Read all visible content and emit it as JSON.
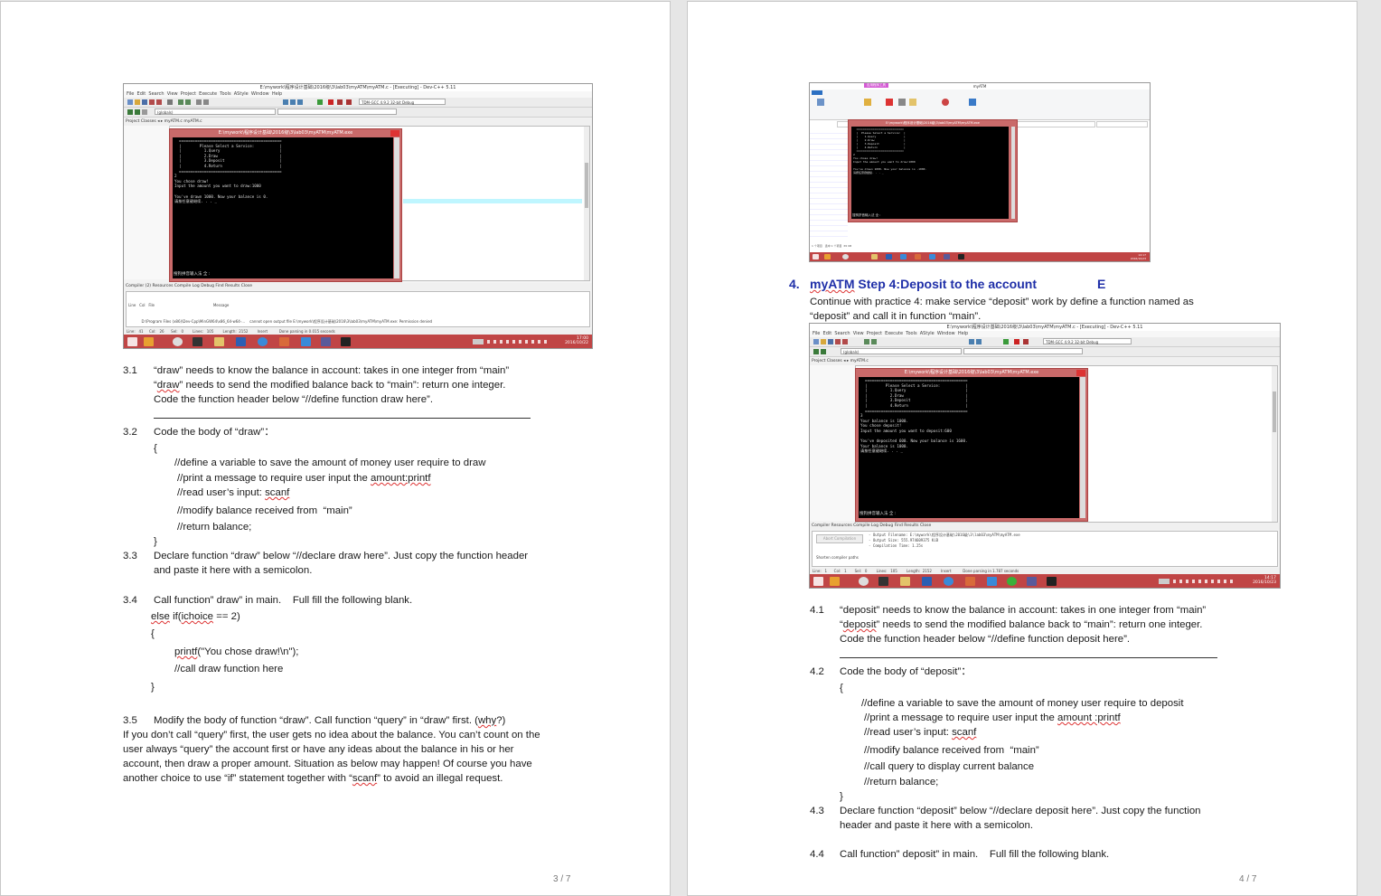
{
  "page_left": {
    "screenshot": {
      "window_title": "E:\\mywork\\程序设计基础\\2016级\\3\\lab03\\myATM\\myATM.c - [Executing] - Dev-C++ 5.11",
      "menu": "File  Edit  Search  View  Project  Execute  Tools  AStyle  Window  Help",
      "compiler_combo": "TDM-GCC 4.9.2 32-bit Debug",
      "globals_combo": "(globals)",
      "tabs": "Project  Classes  ◂ ▸   myATM.c   myATM.c",
      "console_title": "E:\\mywork\\程序设计基础\\2016级\\3\\lab03\\myATM\\myATM.exe",
      "console_text": "  =============================================\n  |        Please Select a Service:           |\n  |          1.Query                          |\n  |          2.Draw                           |\n  |          3.Deposit                        |\n  |          4.Return                         |\n  =============================================\n2\nYou chose draw!\nInput the amount you want to draw:1000\n\nYou've drawn 1000. Now your balance is 0.\n请按任意键继续. . . _",
      "ime_text": "搜狗拼音输入法 全 :",
      "bottom_tabs": "Compiler (2)   Resources   Compile Log   Debug   Find Results   Close",
      "log_header": "Line   Col   File                                                   Message",
      "log_line1": "             D:\\Program Files (x86)\\Dev-Cpp\\MinGW64\\x86_64-w64-...    cannot open output file E:\\mywork\\程序设计基础\\2016\\3\\lab03\\myATM\\myATM.exe: Permission denied",
      "log_line2": "             E:\\mywork\\程序设计基础\\2016\\3\\lab03\\myATM\\coll...          [Error] ld returned 1 exit status",
      "status": "Line:   41     Col:   26      Sel:   0        Lines:   105        Length:  2152        Insert          Done parsing in 0.015 seconds",
      "clock_time": "17:00",
      "clock_date": "2016/10/22"
    },
    "s31_num": "3.1",
    "s31_l1": "“draw” needs to know the balance in account: takes in one integer from “main”",
    "s31_l2a": "“",
    "s31_l2b": "draw",
    "s31_l2c": "” needs to send the modified balance back to “main”: return one integer.",
    "s31_l3": "Code the function header below “//define function draw here”.",
    "s32_num": "3.2",
    "s32_l1": "Code the body of “draw”：",
    "brace_open": "{",
    "s32_c1": "//define a variable to save the amount of money user require to draw",
    "s32_c2a": "//print a message to require user input the ",
    "s32_c2b": "amount:printf",
    "s32_c3a": "//read user’s input: ",
    "s32_c3b": "scanf",
    "s32_c4": "//modify balance received from  “main”",
    "s32_c5": "//return balance;",
    "brace_close": "}",
    "s33_num": "3.3",
    "s33_l1": "Declare function “draw” below “//declare draw here”. Just copy the function header",
    "s33_l2": "and paste it here with a semicolon.",
    "s34_num": "3.4",
    "s34_l1": "Call function” draw” in main.    Full fill the following blank.",
    "s34_c1a": "else",
    "s34_c1b": " if(",
    "s34_c1c": "ichoice",
    "s34_c1d": " == 2)",
    "s34_c2": "{",
    "s34_c3a": "printf",
    "s34_c3b": "(\"You chose draw!\\n\");",
    "s34_c4": "//call draw function here",
    "s34_c5": "}",
    "s35_num": "3.5",
    "s35_l1a": "Modify the body of function “draw”. Call function “query” in “draw” first. (",
    "s35_l1b": "why",
    "s35_l1c": "?)",
    "s35_p1": "If you don’t call “query” first, the user gets no idea about the balance. You can’t count on the",
    "s35_p2": "user always “query” the account first or have any ideas about the balance in his or her",
    "s35_p3": "account, then draw a proper amount. Situation as below may happen! Of course you have",
    "s35_p4a": "another choice to use “if” statement together with “",
    "s35_p4b": "scanf",
    "s35_p4c": "” to avoid an illegal request.",
    "page_number": "3 / 7"
  },
  "page_right": {
    "explorer_shot": {
      "title": "myATM",
      "ribbon_label": "应用程序工具",
      "console_title": "E:\\mywork\\程序设计基础\\2016级\\3\\lab03\\myATM\\myATM.exe",
      "console_text": "  =============================\n  |  Please Select a Service:  |\n  |    1.Query                 |\n  |    2.Draw                  |\n  |    3.Deposit               |\n  |    4.Return                |\n  =============================\n2\nYou chose draw!\nInput the amount you want to draw:1000\n\nYou've drawn 1000. Now your balance is -1000.\n请按任意键继续. . . _",
      "ime_text": "搜狗拼音输入法 全 :",
      "status": "1 个项目   选中 1 个项目  65 KB",
      "clock_time": "14:17",
      "clock_date": "2016/10/23"
    },
    "h4_num": "4.",
    "h4_a": "myATM",
    "h4_b": " Step 4:Deposit to the account",
    "h4_c": "E",
    "intro1": "Continue with practice 4: make service “deposit” work by define a function named as",
    "intro2": "“deposit” and call it in function “main”.",
    "screenshot": {
      "window_title": "E:\\mywork\\程序设计基础\\2016级\\3\\lab03\\myATM\\myATM.c - [Executing] - Dev-C++ 5.11",
      "menu": "File  Edit  Search  View  Project  Execute  Tools  AStyle  Window  Help",
      "compiler_combo": "TDM-GCC 4.9.2 32-bit Debug",
      "globals_combo": "(globals)",
      "tabs": "Project  Classes  ◂ ▸   myATM.c",
      "console_title": "E:\\mywork\\程序设计基础\\2016级\\3\\lab03\\myATM\\myATM.exe",
      "console_text": "  =============================================\n  |        Please Select a Service:           |\n  |          1.Query                          |\n  |          2.Draw                           |\n  |          3.Deposit                        |\n  |          4.Return                         |\n  =============================================\n3\nYour balance is 1000.\nYou chose deposit!\nInput the amount you want to deposit:600\n\nYou've deposited 600. Now your balance is 1600.\nYour balance is 1000.\n请按任意键继续. . . _",
      "ime_text": "搜狗拼音输入法 全 :",
      "bottom_tabs": "Compiler   Resources   Compile Log   Debug   Find Results   Close",
      "abort_label": "Abort Compilation",
      "shorten_label": "Shorten compiler paths",
      "log_text": "- Output Filename: E:\\mywork\\程序设计基础\\2016级\\3\\lab03\\myATM\\myATM.exe\n- Output Size: 555.974609375 KiB\n- Compilation Time: 1.25s",
      "status": "Line:   1      Col:   1       Sel:   0        Lines:   105        Length:  2152        Insert          Done parsing in 1.787 seconds",
      "clock_time": "14:17",
      "clock_date": "2016/10/23"
    },
    "s41_num": "4.1",
    "s41_l1": "“deposit” needs to know the balance in account: takes in one integer from “main”",
    "s41_l2a": "“",
    "s41_l2b": "deposit",
    "s41_l2c": "” needs to send the modified balance back to “main”: return one integer.",
    "s41_l3": "Code the function header below “//define function deposit here”.",
    "s42_num": "4.2",
    "s42_l1": "Code the body of “deposit”：",
    "brace_open": "{",
    "s42_c1": "//define a variable to save the amount of money user require to deposit",
    "s42_c2a": "//print a message to require user input the ",
    "s42_c2b": "amount :printf",
    "s42_c3a": "//read user’s input: ",
    "s42_c3b": "scanf",
    "s42_c4": "//modify balance received from  “main”",
    "s42_c5": "//call query to display current balance",
    "s42_c6": "//return balance;",
    "brace_close": "}",
    "s43_num": "4.3",
    "s43_l1": "Declare function “deposit” below “//declare deposit here”. Just copy the function",
    "s43_l2": "header and paste it here with a semicolon.",
    "s44_num": "4.4",
    "s44_l1": "Call function” deposit” in main.    Full fill the following blank.",
    "page_number": "4 / 7"
  }
}
